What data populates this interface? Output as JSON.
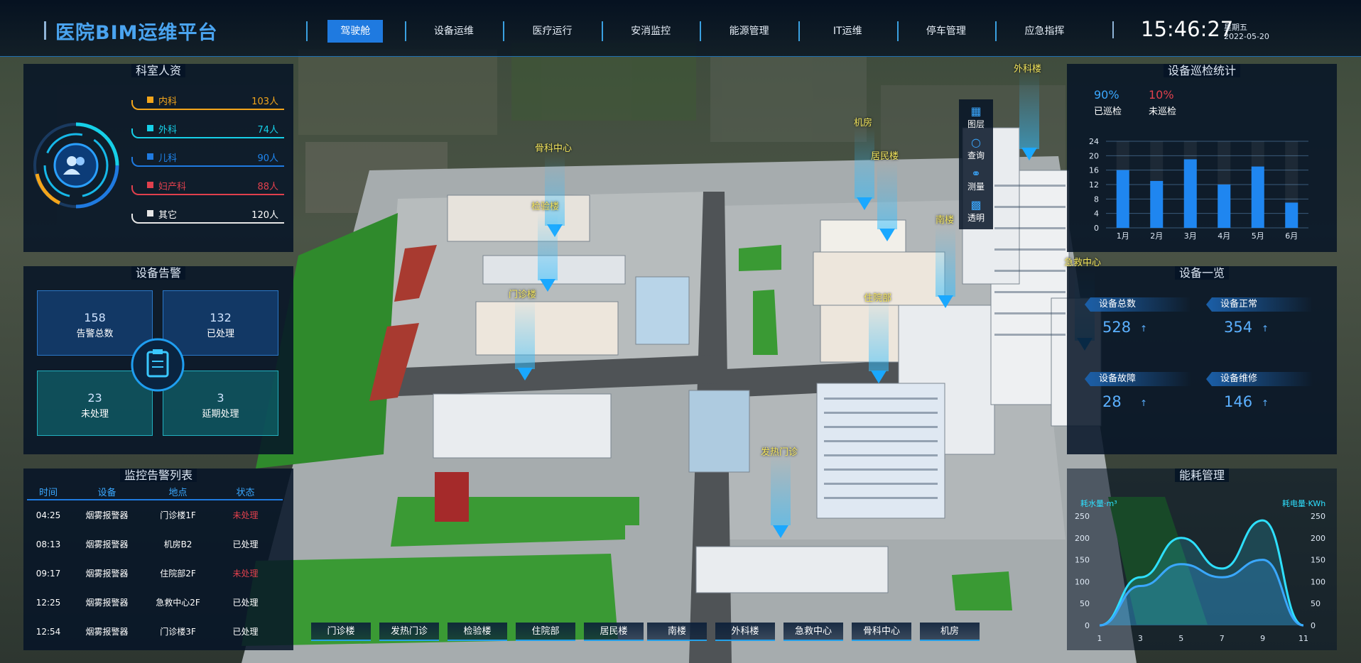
{
  "app": {
    "title": "医院BIM运维平台"
  },
  "nav": {
    "items": [
      "驾驶舱",
      "设备运维",
      "医疗运行",
      "安消监控",
      "能源管理",
      "IT运维",
      "停车管理",
      "应急指挥"
    ],
    "active_index": 0
  },
  "clock": {
    "time": "15:46:27",
    "weekday": "星期五",
    "date": "2022-05-20"
  },
  "staff": {
    "title": "科室人资",
    "rows": [
      {
        "label": "内科",
        "value": "103人",
        "color": "#f3a51b"
      },
      {
        "label": "外科",
        "value": "74人",
        "color": "#16d0e8"
      },
      {
        "label": "儿科",
        "value": "90人",
        "color": "#1f7ae0"
      },
      {
        "label": "妇产科",
        "value": "88人",
        "color": "#e0404d"
      },
      {
        "label": "其它",
        "value": "120人",
        "color": "#e6e6e6"
      }
    ]
  },
  "alarm": {
    "title": "设备告警",
    "total": {
      "value": "158",
      "label": "告警总数"
    },
    "processed": {
      "value": "132",
      "label": "已处理"
    },
    "unprocessed": {
      "value": "23",
      "label": "未处理"
    },
    "delayed": {
      "value": "3",
      "label": "延期处理"
    }
  },
  "alarm_list": {
    "title": "监控告警列表",
    "headers": [
      "时间",
      "设备",
      "地点",
      "状态"
    ],
    "rows": [
      {
        "time": "04:25",
        "device": "烟雾报警器",
        "location": "门诊楼1F",
        "status": "未处理",
        "status_color": "#e0404d"
      },
      {
        "time": "08:13",
        "device": "烟雾报警器",
        "location": "机房B2",
        "status": "已处理",
        "status_color": "#ffffff"
      },
      {
        "time": "09:17",
        "device": "烟雾报警器",
        "location": "住院部2F",
        "status": "未处理",
        "status_color": "#e0404d"
      },
      {
        "time": "12:25",
        "device": "烟雾报警器",
        "location": "急救中心2F",
        "status": "已处理",
        "status_color": "#ffffff"
      },
      {
        "time": "12:54",
        "device": "烟雾报警器",
        "location": "门诊楼3F",
        "status": "已处理",
        "status_color": "#ffffff"
      }
    ]
  },
  "inspection": {
    "title": "设备巡检统计",
    "inspected": {
      "pct": "90%",
      "label": "已巡检",
      "color": "#3aa8ff"
    },
    "not_inspected": {
      "pct": "10%",
      "label": "未巡检",
      "color": "#e0404d"
    }
  },
  "devices": {
    "title": "设备一览",
    "cards": [
      {
        "label": "设备总数",
        "value": "528"
      },
      {
        "label": "设备正常",
        "value": "354"
      },
      {
        "label": "设备故障",
        "value": "28"
      },
      {
        "label": "设备维修",
        "value": "146"
      }
    ],
    "arrow": "↑"
  },
  "energy": {
    "title": "能耗管理",
    "left_unit": "耗水量·m³",
    "right_unit": "耗电量·KWh"
  },
  "tools": [
    {
      "label": "图层",
      "icon": "layers-icon",
      "glyph": "▦"
    },
    {
      "label": "查询",
      "icon": "search-icon",
      "glyph": "○"
    },
    {
      "label": "测量",
      "icon": "measure-icon",
      "glyph": "⚭"
    },
    {
      "label": "透明",
      "icon": "transparent-icon",
      "glyph": "▩"
    }
  ],
  "buildings": [
    "门诊楼",
    "发热门诊",
    "检验楼",
    "住院部",
    "居民楼",
    "南楼",
    "外科楼",
    "急救中心",
    "骨科中心",
    "机房"
  ],
  "map_labels": [
    "外科楼",
    "机房",
    "居民楼",
    "骨科中心",
    "检验楼",
    "南楼",
    "急救中心",
    "门诊楼",
    "住院部",
    "发热门诊"
  ],
  "chart_data": [
    {
      "type": "bar",
      "title": "",
      "categories": [
        "1月",
        "2月",
        "3月",
        "4月",
        "5月",
        "6月"
      ],
      "values": [
        16,
        13,
        19,
        12,
        17,
        7
      ],
      "ylim": [
        0,
        24
      ],
      "yticks": [
        0,
        4,
        8,
        12,
        16,
        20,
        24
      ],
      "grid": true,
      "color": "#1f86f0"
    },
    {
      "type": "line",
      "x": [
        1,
        3,
        5,
        7,
        9,
        11
      ],
      "y_left_ticks": [
        0,
        50,
        100,
        150,
        200,
        250
      ],
      "y_right_ticks": [
        0,
        50,
        100,
        150,
        200,
        250
      ],
      "ylim": [
        0,
        250
      ],
      "series": [
        {
          "name": "耗水量·m³",
          "values": [
            0,
            110,
            200,
            130,
            240,
            0
          ],
          "color": "#2ee0ff"
        },
        {
          "name": "耗电量·KWh",
          "values": [
            0,
            90,
            140,
            110,
            150,
            0
          ],
          "color": "#3aa8ff"
        }
      ]
    }
  ]
}
